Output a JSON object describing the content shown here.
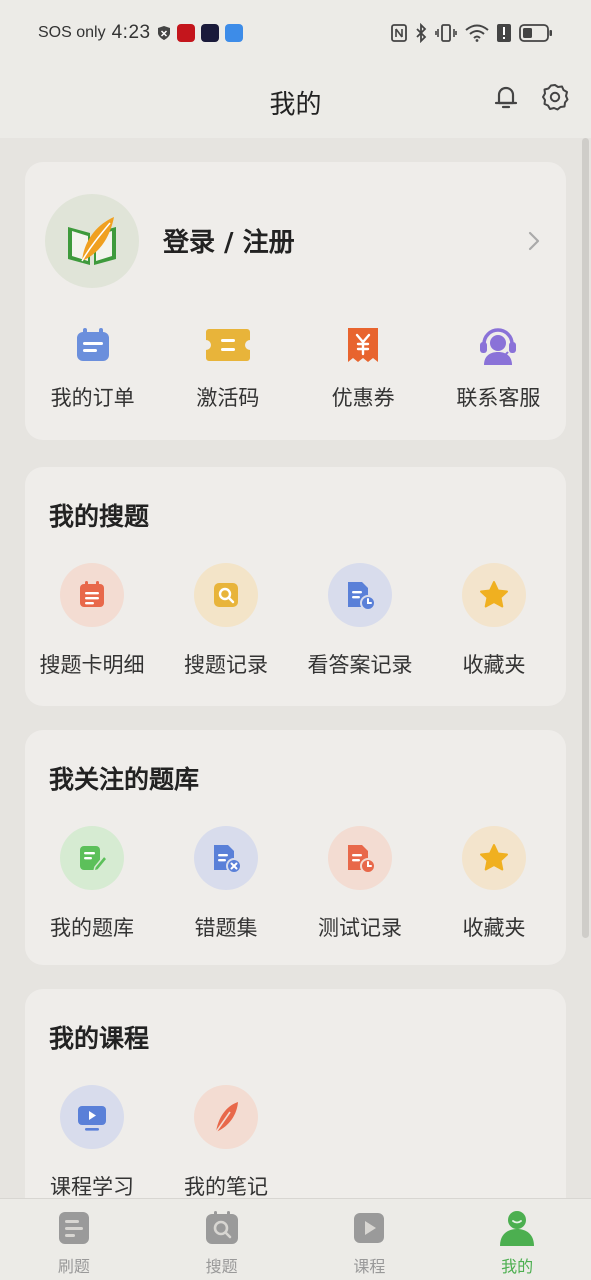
{
  "status_bar": {
    "carrier": "SOS only",
    "time": "4:23"
  },
  "header": {
    "title": "我的"
  },
  "profile": {
    "login_label": "登录 / 注册",
    "quick_actions": [
      {
        "label": "我的订单",
        "icon": "calendar-icon",
        "color": "#6b8fdc"
      },
      {
        "label": "激活码",
        "icon": "ticket-icon",
        "color": "#e8b43a"
      },
      {
        "label": "优惠券",
        "icon": "coupon-icon",
        "color": "#e8642e"
      },
      {
        "label": "联系客服",
        "icon": "headset-icon",
        "color": "#8a72d8"
      }
    ]
  },
  "my_search": {
    "title": "我的搜题",
    "items": [
      {
        "label": "搜题卡明细",
        "icon": "list-card-icon"
      },
      {
        "label": "搜题记录",
        "icon": "search-record-icon"
      },
      {
        "label": "看答案记录",
        "icon": "answer-record-icon"
      },
      {
        "label": "收藏夹",
        "icon": "star-icon"
      }
    ]
  },
  "followed_banks": {
    "title": "我关注的题库",
    "items": [
      {
        "label": "我的题库",
        "icon": "edit-doc-icon"
      },
      {
        "label": "错题集",
        "icon": "wrong-doc-icon"
      },
      {
        "label": "测试记录",
        "icon": "test-record-icon"
      },
      {
        "label": "收藏夹",
        "icon": "star-icon"
      }
    ]
  },
  "my_courses": {
    "title": "我的课程",
    "items": [
      {
        "label": "课程学习",
        "icon": "video-screen-icon"
      },
      {
        "label": "我的笔记",
        "icon": "feather-icon"
      }
    ]
  },
  "bottom_nav": {
    "items": [
      {
        "label": "刷题",
        "active": false
      },
      {
        "label": "搜题",
        "active": false
      },
      {
        "label": "课程",
        "active": false
      },
      {
        "label": "我的",
        "active": true
      }
    ]
  },
  "colors": {
    "accent_green": "#4caf50",
    "card_bg": "#efedea",
    "page_bg": "#e6e4e0"
  }
}
